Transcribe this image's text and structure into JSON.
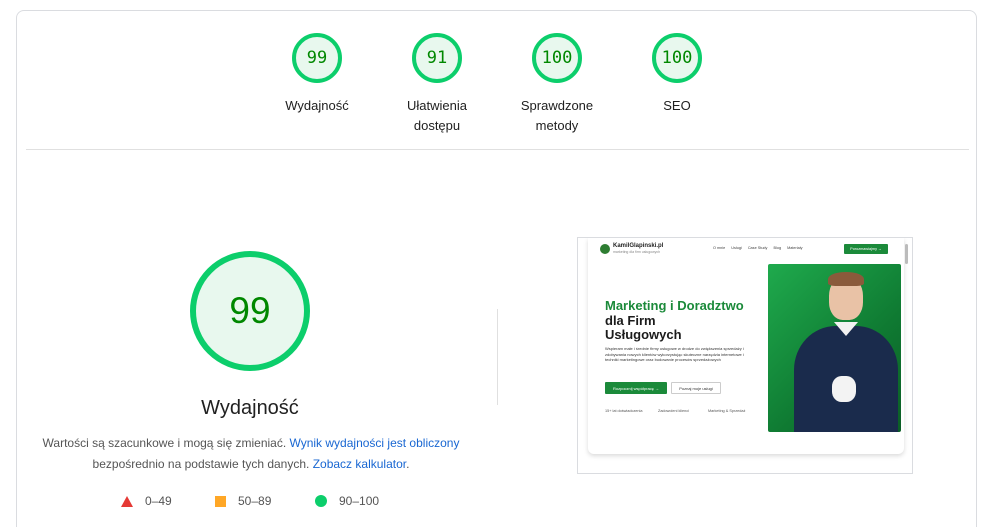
{
  "gauges": [
    {
      "score": "99",
      "label_line1": "Wydajność",
      "label_line2": ""
    },
    {
      "score": "91",
      "label_line1": "Ułatwienia",
      "label_line2": "dostępu"
    },
    {
      "score": "100",
      "label_line1": "Sprawdzone",
      "label_line2": "metody"
    },
    {
      "score": "100",
      "label_line1": "SEO",
      "label_line2": ""
    }
  ],
  "main": {
    "score": "99",
    "title": "Wydajność",
    "desc_part1": "Wartości są szacunkowe i mogą się zmieniać. ",
    "desc_link1": "Wynik wydajności jest obliczony",
    "desc_part2": " bezpośrednio na podstawie tych danych. ",
    "desc_link2": "Zobacz kalkulator",
    "desc_part3": "."
  },
  "legend": [
    {
      "range": "0–49",
      "color": "#e53935",
      "icon": "triangle-icon"
    },
    {
      "range": "50–89",
      "color": "#ffa726",
      "icon": "square-icon"
    },
    {
      "range": "90–100",
      "color": "#0cce6b",
      "icon": "circle-icon"
    }
  ],
  "colors": {
    "pass": "#0cce6b",
    "pass_text": "#008800",
    "pass_bg": "#e8f8ee",
    "link": "#1967d2"
  },
  "screenshot": {
    "brand": "KamilGlapinski.pl",
    "brand_sub": "marketing dla firm usługowych",
    "nav": [
      "O mnie",
      "Usługi",
      "Case Study",
      "Blog",
      "Materiały"
    ],
    "nav_cta": "Porozmawiajmy →",
    "hero_green": "Marketing i Doradztwo",
    "hero_dark1": " dla Firm",
    "hero_dark2": "Usługowych",
    "hero_text": "Wspieram małe i średnie firmy usługowe w drodze do zwiększenia sprzedaży i zdobywania nowych klientów wykorzystując skuteczne narzędzia internetowe i techniki marketingowe oraz budowanie procesów sprzedażowych",
    "btn_primary": "Rozpocznij współpracę →",
    "btn_secondary": "Poznaj moje usługi",
    "features": [
      "15+ lat doświadczenia",
      "Zadowoleni klienci",
      "Marketing & Sprzedaż"
    ]
  }
}
